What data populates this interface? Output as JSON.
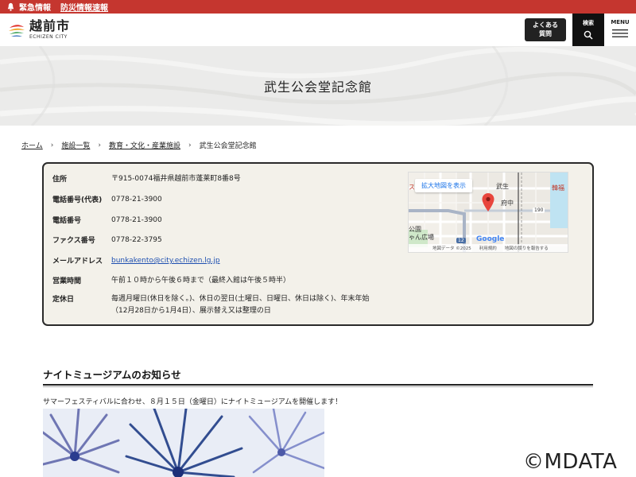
{
  "emergency": {
    "label": "緊急情報",
    "link": "防災情報速報"
  },
  "header": {
    "logo_main": "越前市",
    "logo_sub": "ECHIZEN CITY",
    "faq_line1": "よくある",
    "faq_line2": "質問",
    "search_label": "検索",
    "menu_label": "MENU"
  },
  "banner": {
    "title": "武生公会堂記念館"
  },
  "breadcrumb": {
    "home": "ホーム",
    "facilities": "施設一覧",
    "category": "教育・文化・産業施設",
    "current": "武生公会堂記念館"
  },
  "info": [
    {
      "key": "住所",
      "value": "〒915-0074福井県越前市蓬莱町8番8号"
    },
    {
      "key": "電話番号(代表)",
      "value": "0778-21-3900"
    },
    {
      "key": "電話番号",
      "value": "0778-21-3900"
    },
    {
      "key": "ファクス番号",
      "value": "0778-22-3795"
    },
    {
      "key": "メールアドレス",
      "value": "bunkakento@city.echizen.lg.jp"
    },
    {
      "key": "営業時間",
      "value": "午前１０時から午後６時まで（最終入館は午後５時半）"
    },
    {
      "key": "定休日",
      "value": "毎週月曜日(休日を除く。)、休日の翌日(土曜日、日曜日、休日は除く)、年末年始（12月28日から1月4日）、展示替え又は整理の日"
    }
  ],
  "map": {
    "enlarge_button": "拡大地図を表示",
    "label_takefu": "武生",
    "label_fuchu": "府中",
    "label_kanpuku": "韓福",
    "label_route190": "190",
    "label_route12": "12",
    "label_park1": "公園",
    "label_park2": "ゃん広場",
    "label_su": "ス",
    "google": "Google",
    "footer_data": "地図データ ©2025",
    "footer_terms": "利用規約",
    "footer_report": "地図の誤りを報告する"
  },
  "section": {
    "title": "ナイトミュージアムのお知らせ",
    "text": "サマーフェスティバルに合わせ、８月１５日（金曜日）にナイトミュージアムを開催します！"
  },
  "watermark": "©MDATA"
}
